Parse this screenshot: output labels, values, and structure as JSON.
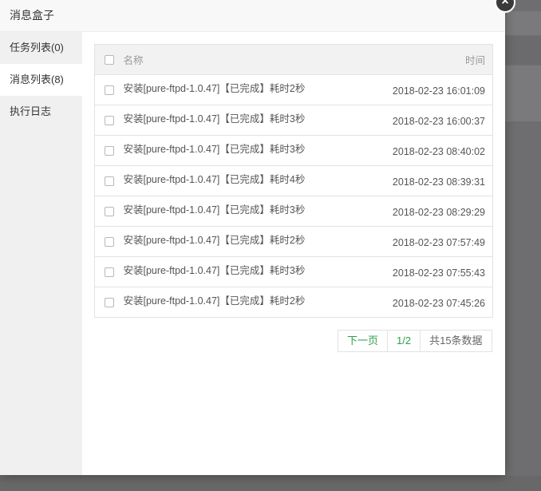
{
  "modal": {
    "title": "消息盒子",
    "close_glyph": "×"
  },
  "sidebar": {
    "items": [
      {
        "label": "任务列表(0)",
        "active": false
      },
      {
        "label": "消息列表(8)",
        "active": true
      },
      {
        "label": "执行日志",
        "active": false
      }
    ]
  },
  "table": {
    "headers": {
      "name": "名称",
      "time": "时间"
    },
    "rows": [
      {
        "name": "安装[pure-ftpd-1.0.47]【已完成】耗时2秒",
        "time": "2018-02-23 16:01:09"
      },
      {
        "name": "安装[pure-ftpd-1.0.47]【已完成】耗时3秒",
        "time": "2018-02-23 16:00:37"
      },
      {
        "name": "安装[pure-ftpd-1.0.47]【已完成】耗时3秒",
        "time": "2018-02-23 08:40:02"
      },
      {
        "name": "安装[pure-ftpd-1.0.47]【已完成】耗时4秒",
        "time": "2018-02-23 08:39:31"
      },
      {
        "name": "安装[pure-ftpd-1.0.47]【已完成】耗时3秒",
        "time": "2018-02-23 08:29:29"
      },
      {
        "name": "安装[pure-ftpd-1.0.47]【已完成】耗时2秒",
        "time": "2018-02-23 07:57:49"
      },
      {
        "name": "安装[pure-ftpd-1.0.47]【已完成】耗时3秒",
        "time": "2018-02-23 07:55:43"
      },
      {
        "name": "安装[pure-ftpd-1.0.47]【已完成】耗时2秒",
        "time": "2018-02-23 07:45:26"
      }
    ]
  },
  "pager": {
    "next_label": "下一页",
    "current": "1/2",
    "total": "共15条数据"
  },
  "colors": {
    "accent": "#2e9e4c",
    "overlay": "#6e6e70"
  }
}
